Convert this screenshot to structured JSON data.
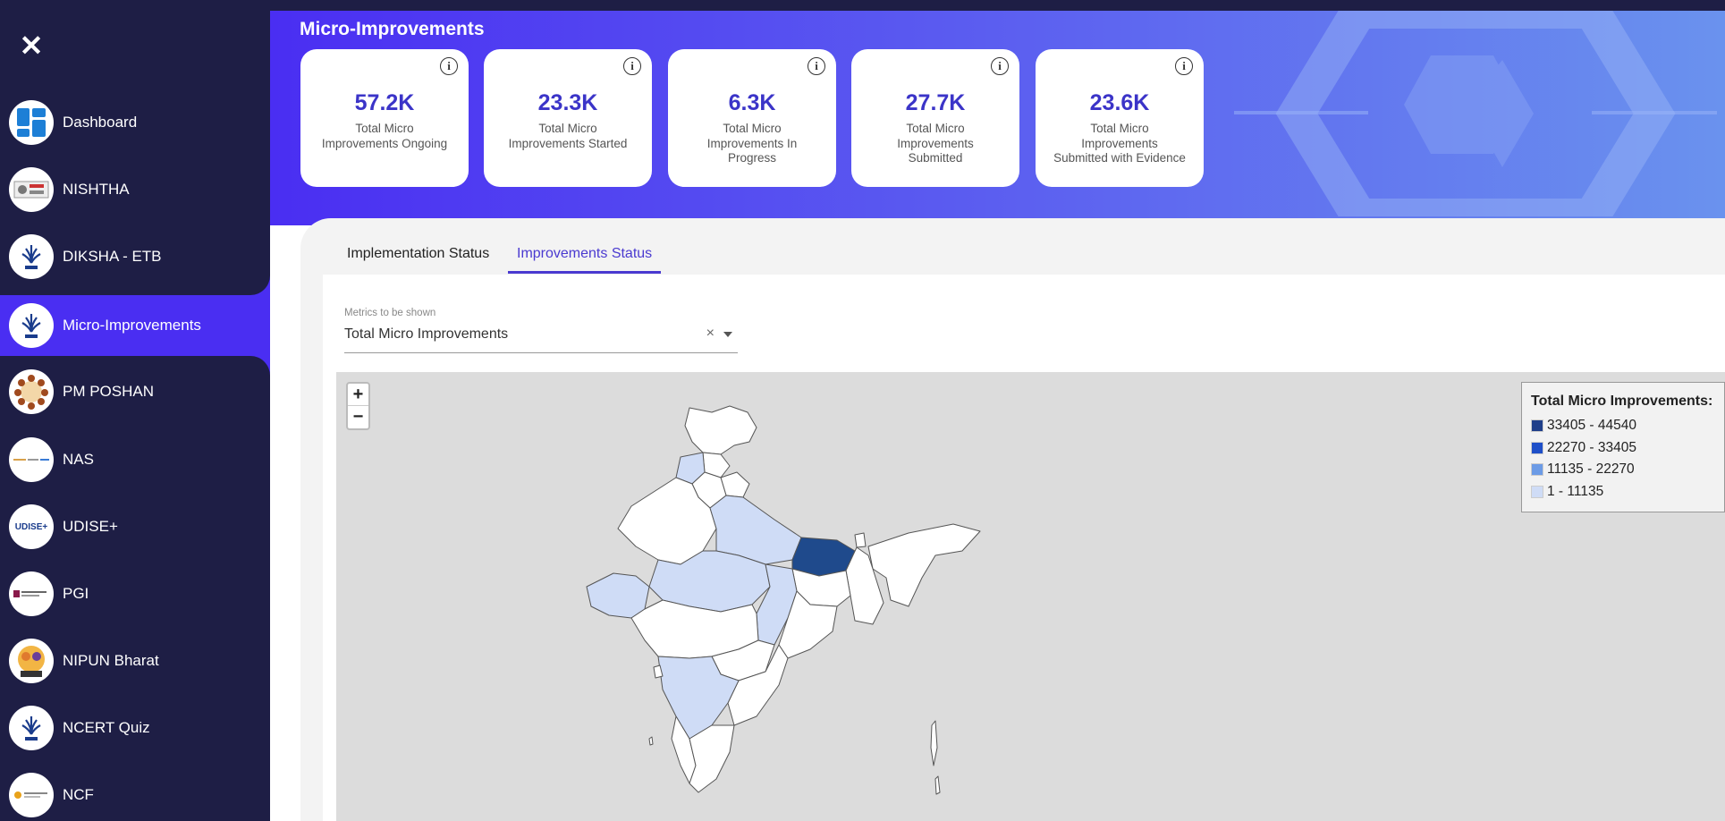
{
  "sidebar": {
    "close_icon": "close-icon",
    "items": [
      {
        "label": "Dashboard",
        "icon": "dashboard-icon",
        "active": false
      },
      {
        "label": "NISHTHA",
        "icon": "nishtha-logo",
        "active": false
      },
      {
        "label": "DIKSHA - ETB",
        "icon": "diksha-logo",
        "active": false
      },
      {
        "label": "Micro-Improvements",
        "icon": "diksha-logo",
        "active": true
      },
      {
        "label": "PM POSHAN",
        "icon": "pm-poshan-logo",
        "active": false
      },
      {
        "label": "NAS",
        "icon": "nas-logo",
        "active": false
      },
      {
        "label": "UDISE+",
        "icon": "udise-logo",
        "active": false
      },
      {
        "label": "PGI",
        "icon": "pgi-logo",
        "active": false
      },
      {
        "label": "NIPUN Bharat",
        "icon": "nipun-logo",
        "active": false
      },
      {
        "label": "NCERT Quiz",
        "icon": "diksha-logo",
        "active": false
      },
      {
        "label": "NCF",
        "icon": "ncf-logo",
        "active": false
      }
    ],
    "udise_logo_text": "UDISE+"
  },
  "header": {
    "title": "Micro-Improvements"
  },
  "kpis": [
    {
      "value": "57.2K",
      "label": "Total Micro Improvements Ongoing"
    },
    {
      "value": "23.3K",
      "label": "Total Micro Improvements Started"
    },
    {
      "value": "6.3K",
      "label": "Total Micro Improvements In Progress"
    },
    {
      "value": "27.7K",
      "label": "Total Micro Improvements Submitted"
    },
    {
      "value": "23.6K",
      "label": "Total Micro Improvements Submitted with Evidence"
    }
  ],
  "tabs": [
    {
      "label": "Implementation Status",
      "active": false
    },
    {
      "label": "Improvements Status",
      "active": true
    }
  ],
  "metric_select": {
    "label": "Metrics to be shown",
    "value": "Total Micro Improvements",
    "clear": "×"
  },
  "map": {
    "zoom_in": "+",
    "zoom_out": "−",
    "legend": {
      "title": "Total Micro Improvements:",
      "ranges": [
        {
          "label": "33405 - 44540",
          "color": "#1f3f8a"
        },
        {
          "label": "22270 - 33405",
          "color": "#1e4fc8"
        },
        {
          "label": "11135 - 22270",
          "color": "#6c9be6"
        },
        {
          "label": "1 - 11135",
          "color": "#cfdcf6"
        }
      ]
    },
    "colors": {
      "unfilled": "#ffffff",
      "light": "#cfdcf6",
      "dark": "#1f4a8c",
      "border": "#555555",
      "background": "#dcdcdc"
    }
  },
  "colors": {
    "sidebar": "#1e1e45",
    "accent": "#4a2ef2",
    "kpi_value": "#3b34c8"
  }
}
